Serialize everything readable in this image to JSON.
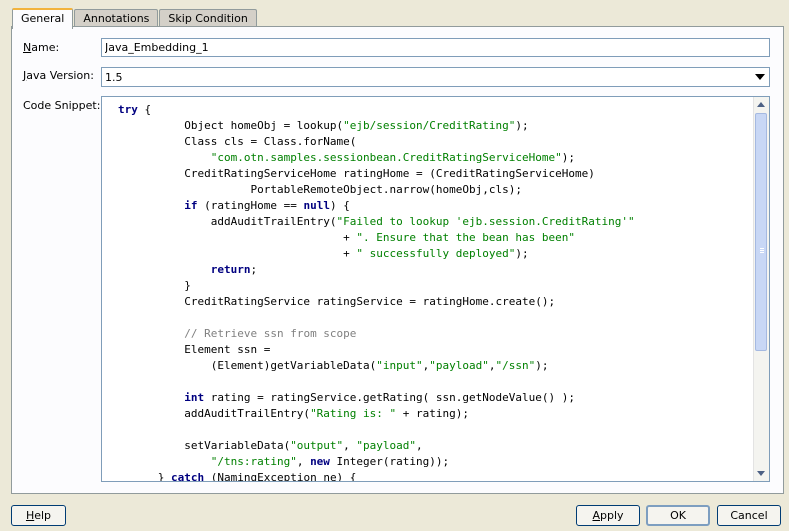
{
  "tabs": [
    {
      "label": "General",
      "active": true
    },
    {
      "label": "Annotations",
      "active": false
    },
    {
      "label": "Skip Condition",
      "active": false
    }
  ],
  "form": {
    "name_label_mnemonic": "N",
    "name_label_rest": "ame:",
    "name_value": "Java_Embedding_1",
    "version_label_mnemonic": "J",
    "version_label_rest": "ava Version:",
    "version_value": "1.5",
    "snippet_label": "Code Snippet:"
  },
  "code_lines": [
    [
      {
        "t": "try",
        "c": "kw"
      },
      {
        "t": " {"
      }
    ],
    [
      {
        "t": "          Object homeObj = lookup("
      },
      {
        "t": "\"ejb/session/CreditRating\"",
        "c": "str"
      },
      {
        "t": ");"
      }
    ],
    [
      {
        "t": "          Class cls = Class.forName("
      }
    ],
    [
      {
        "t": "              "
      },
      {
        "t": "\"com.otn.samples.sessionbean.CreditRatingServiceHome\"",
        "c": "str"
      },
      {
        "t": ");"
      }
    ],
    [
      {
        "t": "          CreditRatingServiceHome ratingHome = (CreditRatingServiceHome)"
      }
    ],
    [
      {
        "t": "                    PortableRemoteObject.narrow(homeObj,cls);"
      }
    ],
    [
      {
        "t": "          "
      },
      {
        "t": "if",
        "c": "kw"
      },
      {
        "t": " (ratingHome == "
      },
      {
        "t": "null",
        "c": "kw"
      },
      {
        "t": ") {"
      }
    ],
    [
      {
        "t": "              addAuditTrailEntry("
      },
      {
        "t": "\"Failed to lookup 'ejb.session.CreditRating'\"",
        "c": "str"
      }
    ],
    [
      {
        "t": "                                  + "
      },
      {
        "t": "\". Ensure that the bean has been\"",
        "c": "str"
      }
    ],
    [
      {
        "t": "                                  + "
      },
      {
        "t": "\" successfully deployed\"",
        "c": "str"
      },
      {
        "t": ");"
      }
    ],
    [
      {
        "t": "              "
      },
      {
        "t": "return",
        "c": "kw"
      },
      {
        "t": ";"
      }
    ],
    [
      {
        "t": "          }"
      }
    ],
    [
      {
        "t": "          CreditRatingService ratingService = ratingHome.create();"
      }
    ],
    [
      {
        "t": ""
      }
    ],
    [
      {
        "t": "          "
      },
      {
        "t": "// Retrieve ssn from scope",
        "c": "cm"
      }
    ],
    [
      {
        "t": "          Element ssn ="
      }
    ],
    [
      {
        "t": "              (Element)getVariableData("
      },
      {
        "t": "\"input\"",
        "c": "str"
      },
      {
        "t": ","
      },
      {
        "t": "\"payload\"",
        "c": "str"
      },
      {
        "t": ","
      },
      {
        "t": "\"/ssn\"",
        "c": "str"
      },
      {
        "t": ");"
      }
    ],
    [
      {
        "t": ""
      }
    ],
    [
      {
        "t": "          "
      },
      {
        "t": "int",
        "c": "kw"
      },
      {
        "t": " rating = ratingService.getRating( ssn.getNodeValue() );"
      }
    ],
    [
      {
        "t": "          addAuditTrailEntry("
      },
      {
        "t": "\"Rating is: \"",
        "c": "str"
      },
      {
        "t": " + rating);"
      }
    ],
    [
      {
        "t": ""
      }
    ],
    [
      {
        "t": "          setVariableData("
      },
      {
        "t": "\"output\"",
        "c": "str"
      },
      {
        "t": ", "
      },
      {
        "t": "\"payload\"",
        "c": "str"
      },
      {
        "t": ","
      }
    ],
    [
      {
        "t": "              "
      },
      {
        "t": "\"/tns:rating\"",
        "c": "str"
      },
      {
        "t": ", "
      },
      {
        "t": "new",
        "c": "kw"
      },
      {
        "t": " Integer(rating));"
      }
    ],
    [
      {
        "t": "      } "
      },
      {
        "t": "catch",
        "c": "kw"
      },
      {
        "t": " (NamingException ne) {"
      }
    ]
  ],
  "buttons": {
    "help_mnemonic": "H",
    "help_rest": "elp",
    "apply_mnemonic": "A",
    "apply_rest": "pply",
    "ok": "OK",
    "cancel": "Cancel"
  }
}
